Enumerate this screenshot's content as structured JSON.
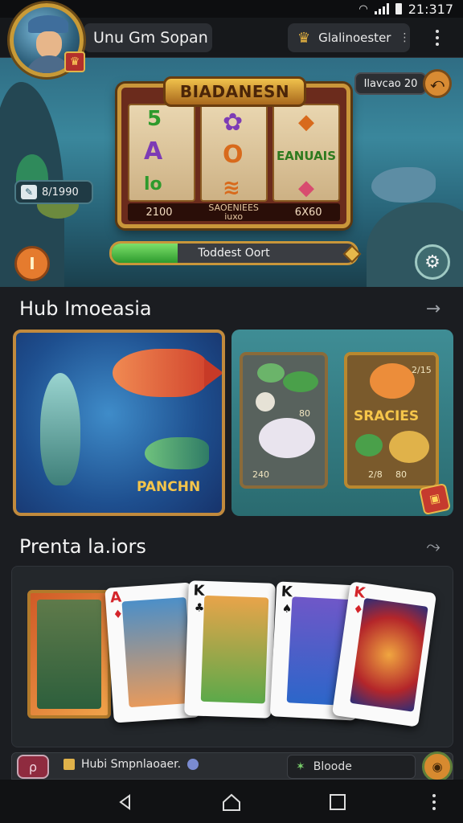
{
  "status_bar": {
    "time": "21:317"
  },
  "header": {
    "username": "Unu Gm Sopan",
    "balance_label": "Glalinoester",
    "avatar_badge": "♛"
  },
  "hero": {
    "slot_title": "BIADANESN",
    "reel_symbols": [
      [
        "5",
        "A",
        "lo"
      ],
      [
        "✿",
        "O",
        "≋"
      ],
      [
        "◆",
        "EANUAIS",
        "◆"
      ]
    ],
    "payline": [
      "2100",
      "SAOENIEES",
      "6X60"
    ],
    "payline_sub": "iuxo",
    "tag_value": "8/1990",
    "chip_label": "Ilavcao 20",
    "progress_label": "Toddest Oort",
    "progress_fraction": 0.27
  },
  "sections": {
    "hub_title": "Hub Imoeasia",
    "preview_title": "Prenta la.iors"
  },
  "hub_cards": {
    "left_caption": "PANCHN",
    "right_caption": "SRACIES",
    "panel_a_numbers": [
      "240",
      "80"
    ],
    "panel_b_numbers": [
      "2/15",
      "2/8",
      "80"
    ]
  },
  "playing_cards": [
    {
      "rank": "A",
      "suit": "♦",
      "color": "red"
    },
    {
      "rank": "K",
      "suit": "♣",
      "color": "black"
    },
    {
      "rank": "K",
      "suit": "♠",
      "color": "black"
    },
    {
      "rank": "K",
      "suit": "♦",
      "color": "red"
    }
  ],
  "bottom_strip": {
    "label": "Hubi Smpnlaoaer.",
    "tag_label": "Bloode"
  },
  "colors": {
    "background": "#1b1d21",
    "gold": "#c9963a",
    "progress_green": "#2d9b2e"
  }
}
